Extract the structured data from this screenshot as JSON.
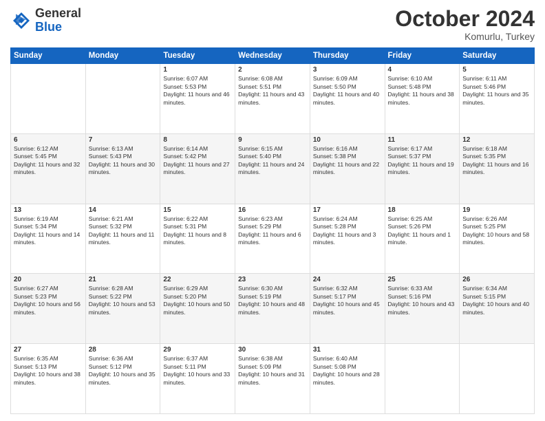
{
  "header": {
    "logo": {
      "line1": "General",
      "line2": "Blue"
    },
    "month": "October 2024",
    "location": "Komurlu, Turkey"
  },
  "weekdays": [
    "Sunday",
    "Monday",
    "Tuesday",
    "Wednesday",
    "Thursday",
    "Friday",
    "Saturday"
  ],
  "weeks": [
    [
      {
        "day": "",
        "sunrise": "",
        "sunset": "",
        "daylight": ""
      },
      {
        "day": "",
        "sunrise": "",
        "sunset": "",
        "daylight": ""
      },
      {
        "day": "1",
        "sunrise": "Sunrise: 6:07 AM",
        "sunset": "Sunset: 5:53 PM",
        "daylight": "Daylight: 11 hours and 46 minutes."
      },
      {
        "day": "2",
        "sunrise": "Sunrise: 6:08 AM",
        "sunset": "Sunset: 5:51 PM",
        "daylight": "Daylight: 11 hours and 43 minutes."
      },
      {
        "day": "3",
        "sunrise": "Sunrise: 6:09 AM",
        "sunset": "Sunset: 5:50 PM",
        "daylight": "Daylight: 11 hours and 40 minutes."
      },
      {
        "day": "4",
        "sunrise": "Sunrise: 6:10 AM",
        "sunset": "Sunset: 5:48 PM",
        "daylight": "Daylight: 11 hours and 38 minutes."
      },
      {
        "day": "5",
        "sunrise": "Sunrise: 6:11 AM",
        "sunset": "Sunset: 5:46 PM",
        "daylight": "Daylight: 11 hours and 35 minutes."
      }
    ],
    [
      {
        "day": "6",
        "sunrise": "Sunrise: 6:12 AM",
        "sunset": "Sunset: 5:45 PM",
        "daylight": "Daylight: 11 hours and 32 minutes."
      },
      {
        "day": "7",
        "sunrise": "Sunrise: 6:13 AM",
        "sunset": "Sunset: 5:43 PM",
        "daylight": "Daylight: 11 hours and 30 minutes."
      },
      {
        "day": "8",
        "sunrise": "Sunrise: 6:14 AM",
        "sunset": "Sunset: 5:42 PM",
        "daylight": "Daylight: 11 hours and 27 minutes."
      },
      {
        "day": "9",
        "sunrise": "Sunrise: 6:15 AM",
        "sunset": "Sunset: 5:40 PM",
        "daylight": "Daylight: 11 hours and 24 minutes."
      },
      {
        "day": "10",
        "sunrise": "Sunrise: 6:16 AM",
        "sunset": "Sunset: 5:38 PM",
        "daylight": "Daylight: 11 hours and 22 minutes."
      },
      {
        "day": "11",
        "sunrise": "Sunrise: 6:17 AM",
        "sunset": "Sunset: 5:37 PM",
        "daylight": "Daylight: 11 hours and 19 minutes."
      },
      {
        "day": "12",
        "sunrise": "Sunrise: 6:18 AM",
        "sunset": "Sunset: 5:35 PM",
        "daylight": "Daylight: 11 hours and 16 minutes."
      }
    ],
    [
      {
        "day": "13",
        "sunrise": "Sunrise: 6:19 AM",
        "sunset": "Sunset: 5:34 PM",
        "daylight": "Daylight: 11 hours and 14 minutes."
      },
      {
        "day": "14",
        "sunrise": "Sunrise: 6:21 AM",
        "sunset": "Sunset: 5:32 PM",
        "daylight": "Daylight: 11 hours and 11 minutes."
      },
      {
        "day": "15",
        "sunrise": "Sunrise: 6:22 AM",
        "sunset": "Sunset: 5:31 PM",
        "daylight": "Daylight: 11 hours and 8 minutes."
      },
      {
        "day": "16",
        "sunrise": "Sunrise: 6:23 AM",
        "sunset": "Sunset: 5:29 PM",
        "daylight": "Daylight: 11 hours and 6 minutes."
      },
      {
        "day": "17",
        "sunrise": "Sunrise: 6:24 AM",
        "sunset": "Sunset: 5:28 PM",
        "daylight": "Daylight: 11 hours and 3 minutes."
      },
      {
        "day": "18",
        "sunrise": "Sunrise: 6:25 AM",
        "sunset": "Sunset: 5:26 PM",
        "daylight": "Daylight: 11 hours and 1 minute."
      },
      {
        "day": "19",
        "sunrise": "Sunrise: 6:26 AM",
        "sunset": "Sunset: 5:25 PM",
        "daylight": "Daylight: 10 hours and 58 minutes."
      }
    ],
    [
      {
        "day": "20",
        "sunrise": "Sunrise: 6:27 AM",
        "sunset": "Sunset: 5:23 PM",
        "daylight": "Daylight: 10 hours and 56 minutes."
      },
      {
        "day": "21",
        "sunrise": "Sunrise: 6:28 AM",
        "sunset": "Sunset: 5:22 PM",
        "daylight": "Daylight: 10 hours and 53 minutes."
      },
      {
        "day": "22",
        "sunrise": "Sunrise: 6:29 AM",
        "sunset": "Sunset: 5:20 PM",
        "daylight": "Daylight: 10 hours and 50 minutes."
      },
      {
        "day": "23",
        "sunrise": "Sunrise: 6:30 AM",
        "sunset": "Sunset: 5:19 PM",
        "daylight": "Daylight: 10 hours and 48 minutes."
      },
      {
        "day": "24",
        "sunrise": "Sunrise: 6:32 AM",
        "sunset": "Sunset: 5:17 PM",
        "daylight": "Daylight: 10 hours and 45 minutes."
      },
      {
        "day": "25",
        "sunrise": "Sunrise: 6:33 AM",
        "sunset": "Sunset: 5:16 PM",
        "daylight": "Daylight: 10 hours and 43 minutes."
      },
      {
        "day": "26",
        "sunrise": "Sunrise: 6:34 AM",
        "sunset": "Sunset: 5:15 PM",
        "daylight": "Daylight: 10 hours and 40 minutes."
      }
    ],
    [
      {
        "day": "27",
        "sunrise": "Sunrise: 6:35 AM",
        "sunset": "Sunset: 5:13 PM",
        "daylight": "Daylight: 10 hours and 38 minutes."
      },
      {
        "day": "28",
        "sunrise": "Sunrise: 6:36 AM",
        "sunset": "Sunset: 5:12 PM",
        "daylight": "Daylight: 10 hours and 35 minutes."
      },
      {
        "day": "29",
        "sunrise": "Sunrise: 6:37 AM",
        "sunset": "Sunset: 5:11 PM",
        "daylight": "Daylight: 10 hours and 33 minutes."
      },
      {
        "day": "30",
        "sunrise": "Sunrise: 6:38 AM",
        "sunset": "Sunset: 5:09 PM",
        "daylight": "Daylight: 10 hours and 31 minutes."
      },
      {
        "day": "31",
        "sunrise": "Sunrise: 6:40 AM",
        "sunset": "Sunset: 5:08 PM",
        "daylight": "Daylight: 10 hours and 28 minutes."
      },
      {
        "day": "",
        "sunrise": "",
        "sunset": "",
        "daylight": ""
      },
      {
        "day": "",
        "sunrise": "",
        "sunset": "",
        "daylight": ""
      }
    ]
  ]
}
